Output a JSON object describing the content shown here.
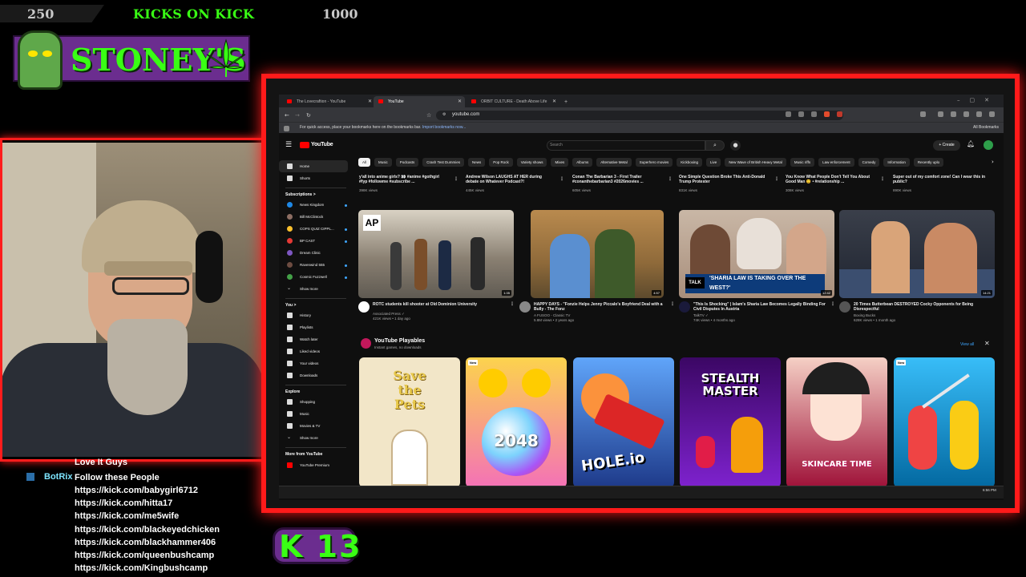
{
  "stream": {
    "goal_left": "250",
    "goal_title": "KICKS ON KICK",
    "goal_right": "1000",
    "logo_text": "STONEY'S",
    "badge_text": "K 13",
    "chat": {
      "first_line": "Love It Guys",
      "bot_user": "BotRix",
      "bot_message": "Follow these People",
      "links": [
        "https://kick.com/babygirl6712",
        "https://kick.com/hitta17",
        "https://kick.com/me5wife",
        "https://kick.com/blackeyedchicken",
        "https://kick.com/blackhammer406",
        "https://kick.com/queenbushcamp",
        "https://kick.com/Kingbushcamp"
      ]
    }
  },
  "browser": {
    "tabs": [
      {
        "label": "The Lovecraftion - YouTube"
      },
      {
        "label": "YouTube"
      },
      {
        "label": "ORBIT CULTURE - Death Above Life"
      }
    ],
    "new_tab": "+",
    "url": "youtube.com",
    "bookmarks_text": "For quick access, place your bookmarks here on the bookmarks bar.",
    "bookmarks_link": "Import bookmarks now...",
    "all_bookmarks": "All Bookmarks"
  },
  "youtube": {
    "logo": "YouTube",
    "search_placeholder": "Search",
    "create_label": "+ Create",
    "chips": [
      "All",
      "Music",
      "Podcasts",
      "Crash Test Dummies",
      "News",
      "Pop Rock",
      "Variety shows",
      "Mixes",
      "Albums",
      "Alternative Metal",
      "Superhero movies",
      "Kickboxing",
      "Live",
      "New Wave of British Heavy Metal",
      "Music riffs",
      "Law enforcement",
      "Comedy",
      "Information",
      "Recently uplo"
    ],
    "sidebar": {
      "main": [
        "Home",
        "Shorts"
      ],
      "subs_head": "Subscriptions  >",
      "subs": [
        "News Kingdom",
        "Bill McClintock",
        "COPS QUIZ CIPPL...",
        "BP CAST",
        "Dream Clinic",
        "Ravenwind 555",
        "Cosmic Fuzzwell"
      ],
      "show_more": "Show more",
      "you_head": "You  >",
      "you": [
        "History",
        "Playlists",
        "Watch later",
        "Liked videos",
        "Your videos",
        "Downloads"
      ],
      "explore_head": "Explore",
      "explore": [
        "Shopping",
        "Music",
        "Movies & TV"
      ],
      "show_more_2": "Show more",
      "more_head": "More from YouTube",
      "more": [
        "YouTube Premium"
      ]
    },
    "top_row": [
      {
        "title": "y'all into anime girls? 👀 #anime #gothgirl #fyp #followme #subscribe ...",
        "meta": "398K views"
      },
      {
        "title": "Andrew Wilson LAUGHS AT HER during debate on Whatever Podcast?!",
        "meta": "445K views"
      },
      {
        "title": "Conan The Barbarian 3 - First Trailer #conanthebarbarian3 #2026movies ...",
        "meta": "605K views"
      },
      {
        "title": "One Simple Question Broke This Anti-Donald Trump Protester",
        "meta": "831K views"
      },
      {
        "title": "You Know What People Don't Tell You About Good Man 😊 • #relationship ...",
        "meta": "308K views"
      },
      {
        "title": "Super out of my comfort zone! Can I wear this in public?",
        "meta": "890K views"
      }
    ],
    "videos": [
      {
        "title": "ROTC students kill shooter at Old Dominion University",
        "channel": "Associated Press ✓",
        "meta": "421K views • 1 day ago",
        "duration": "1:35",
        "thumb_text": "AP"
      },
      {
        "title": "HAPPY DAYS - \"Fonzie Helps Jenny Piccalo's Boyfriend Deal with a Bully - The Fonz",
        "channel": "A FUSOO - Classic TV",
        "meta": "5.8M views • 2 years ago",
        "duration": "4:57",
        "thumb_text": ""
      },
      {
        "title": "\"This Is Shocking\" | Islam's Sharia Law Becomes Legally Binding For Civil Disputes In Austria",
        "channel": "TalkTV ✓",
        "meta": "74K views • 4 months ago",
        "duration": "12:42",
        "thumb_text": "'SHARIA LAW IS TAKING OVER THE WEST?'"
      },
      {
        "title": "20 Times Butterbean DESTROYED Cocky Opponents for Being Disrespectful",
        "channel": "Boxing Bucks",
        "meta": "628K views • 1 month ago",
        "duration": "14:21",
        "thumb_text": ""
      }
    ],
    "playables": {
      "title": "YouTube Playables",
      "subtitle": "Instant games, no downloads",
      "view_all": "View all",
      "games": [
        {
          "name": "Save the Pets",
          "new": ""
        },
        {
          "name": "2048",
          "new": "New"
        },
        {
          "name": "HOLE.io",
          "new": ""
        },
        {
          "name": "STEALTH MASTER",
          "new": ""
        },
        {
          "name": "SKINCARE TIME",
          "new": ""
        },
        {
          "name": "",
          "new": "New"
        }
      ]
    },
    "taskbar_time": "6:56 PM"
  },
  "colors": {
    "neon_green": "#39ff14",
    "frame_red": "#ff1a1a",
    "logo_purple": "#6b2d8f",
    "yt_red": "#ff0000",
    "yt_bg": "#0f0f0f"
  }
}
